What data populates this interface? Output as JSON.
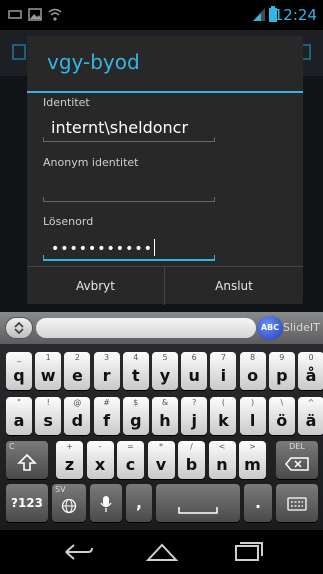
{
  "status_bar": {
    "time": "12:24",
    "icons": [
      "notification-icon",
      "image-icon",
      "wifi-icon",
      "signal-icon",
      "battery-icon"
    ],
    "accent_color": "#33b5e5"
  },
  "dialog": {
    "title": "vgy-byod",
    "fields": [
      {
        "label": "Identitet",
        "value": "internt\\sheldoncr"
      },
      {
        "label": "Anonym identitet",
        "value": ""
      },
      {
        "label": "Lösenord",
        "value": "•••••••••••"
      }
    ],
    "cancel_label": "Avbryt",
    "connect_label": "Anslut"
  },
  "keyboard": {
    "brand": "SlideIT",
    "abc_label": "ABC",
    "row1": [
      {
        "main": "q",
        "sec": "_"
      },
      {
        "main": "w",
        "sec": "1"
      },
      {
        "main": "e",
        "sec": "2"
      },
      {
        "main": "r",
        "sec": "3"
      },
      {
        "main": "t",
        "sec": "4"
      },
      {
        "main": "y",
        "sec": "5"
      },
      {
        "main": "u",
        "sec": "6"
      },
      {
        "main": "i",
        "sec": "7"
      },
      {
        "main": "o",
        "sec": "8"
      },
      {
        "main": "p",
        "sec": "9"
      },
      {
        "main": "å",
        "sec": "0"
      }
    ],
    "row2": [
      {
        "main": "a",
        "sec": "\""
      },
      {
        "main": "s",
        "sec": "!"
      },
      {
        "main": "d",
        "sec": "@"
      },
      {
        "main": "f",
        "sec": "#"
      },
      {
        "main": "g",
        "sec": "$"
      },
      {
        "main": "h",
        "sec": "&"
      },
      {
        "main": "j",
        "sec": "?"
      },
      {
        "main": "k",
        "sec": "("
      },
      {
        "main": "l",
        "sec": ")"
      },
      {
        "main": "ö",
        "sec": "\\"
      },
      {
        "main": "ä",
        "sec": "^"
      }
    ],
    "row3": [
      {
        "main": "z",
        "sec": "+"
      },
      {
        "main": "x",
        "sec": "-"
      },
      {
        "main": "c",
        "sec": "="
      },
      {
        "main": "v",
        "sec": "*"
      },
      {
        "main": "b",
        "sec": "/"
      },
      {
        "main": "n",
        "sec": "<"
      },
      {
        "main": "m",
        "sec": ">"
      }
    ],
    "shift_sec": "C",
    "del_label": "DEL",
    "sym_label": "?123",
    "lang_label": "SV",
    "comma_label": ",",
    "period_label": "."
  }
}
